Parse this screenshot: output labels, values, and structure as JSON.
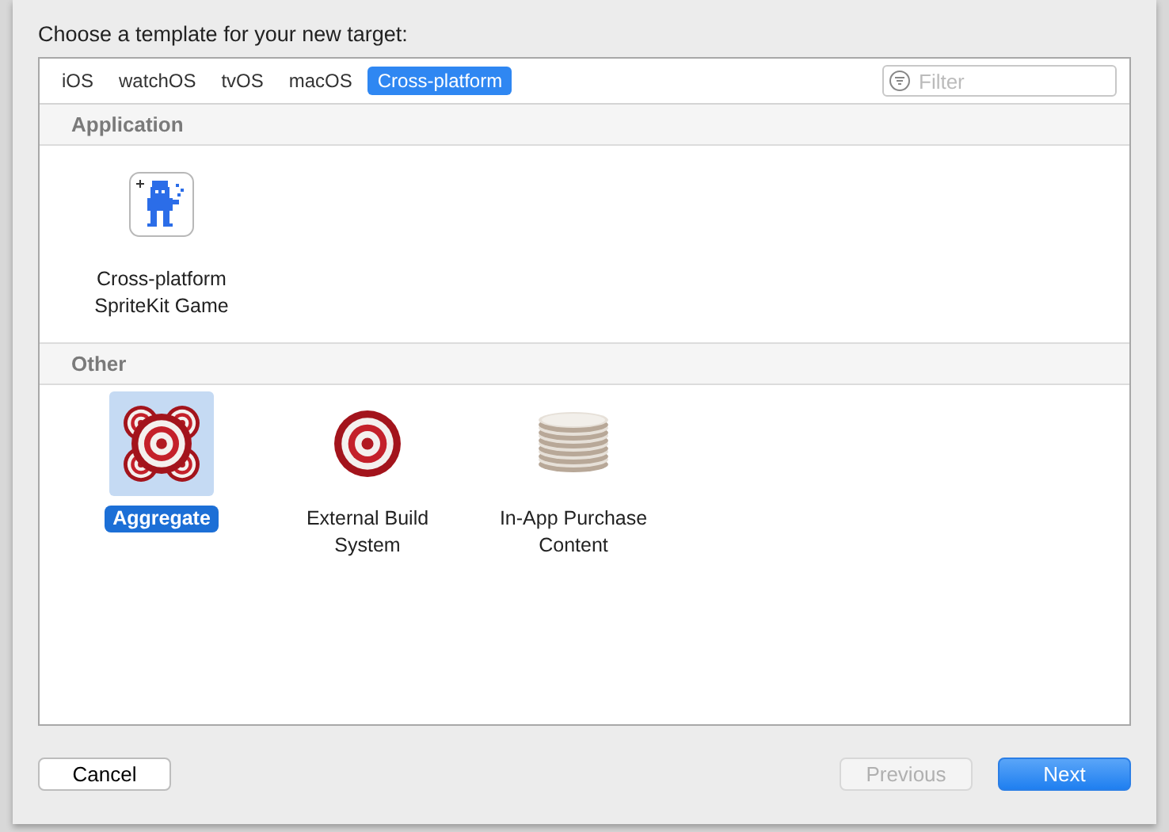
{
  "prompt": "Choose a template for your new target:",
  "tabs": [
    {
      "label": "iOS",
      "selected": false
    },
    {
      "label": "watchOS",
      "selected": false
    },
    {
      "label": "tvOS",
      "selected": false
    },
    {
      "label": "macOS",
      "selected": false
    },
    {
      "label": "Cross-platform",
      "selected": true
    }
  ],
  "filter": {
    "placeholder": "Filter"
  },
  "sections": [
    {
      "title": "Application",
      "items": [
        {
          "label": "Cross-platform SpriteKit Game",
          "kind": "sprite",
          "selected": false
        }
      ]
    },
    {
      "title": "Other",
      "items": [
        {
          "label": "Aggregate",
          "kind": "targets",
          "selected": true
        },
        {
          "label": "External Build System",
          "kind": "target",
          "selected": false
        },
        {
          "label": "In-App Purchase Content",
          "kind": "coins",
          "selected": false
        }
      ]
    }
  ],
  "buttons": [
    {
      "label": "Cancel",
      "kind": "cancel",
      "disabled": false
    },
    {
      "label": "Previous",
      "kind": "secondary",
      "disabled": true
    },
    {
      "label": "Next",
      "kind": "primary",
      "disabled": false
    }
  ]
}
